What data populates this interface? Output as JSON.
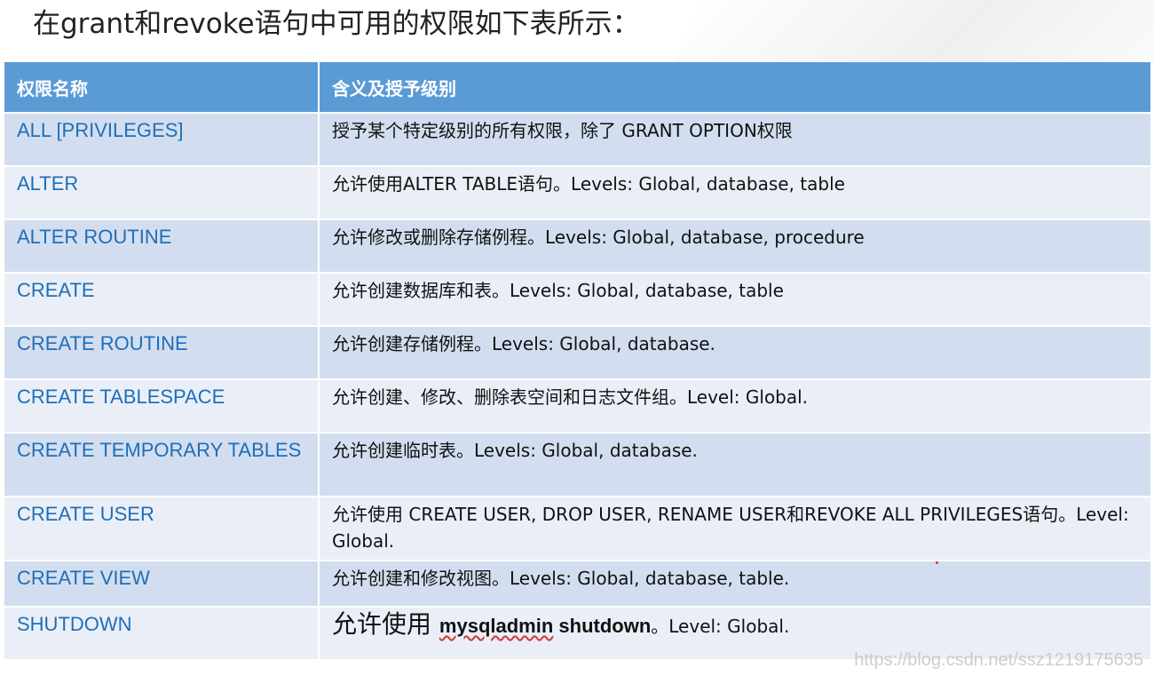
{
  "title": "在grant和revoke语句中可用的权限如下表所示：",
  "table": {
    "headers": [
      "权限名称",
      "含义及授予级别"
    ],
    "rows": [
      {
        "name": "ALL [PRIVILEGES]",
        "desc": "授予某个特定级别的所有权限，除了 GRANT  OPTION权限"
      },
      {
        "name": "ALTER",
        "desc": "允许使用ALTER  TABLE语句。Levels: Global, database, table"
      },
      {
        "name": "ALTER ROUTINE",
        "desc": "允许修改或删除存储例程。Levels: Global, database, procedure"
      },
      {
        "name": "CREATE",
        "desc": "允许创建数据库和表。Levels: Global, database, table"
      },
      {
        "name": "CREATE ROUTINE",
        "desc": "允许创建存储例程。Levels: Global, database."
      },
      {
        "name": "CREATE TABLESPACE",
        "desc": "允许创建、修改、删除表空间和日志文件组。Level: Global."
      },
      {
        "name": "CREATE TEMPORARY TABLES",
        "desc": "允许创建临时表。Levels: Global, database."
      },
      {
        "name": "CREATE USER",
        "desc": "允许使用 CREATE USER, DROP USER, RENAME USER和REVOKE ALL PRIVILEGES语句。Level: Global."
      },
      {
        "name": "CREATE VIEW",
        "desc": "允许创建和修改视图。Levels: Global, database, table."
      }
    ],
    "last_row": {
      "name": "SHUTDOWN",
      "desc_big": "允许使用 ",
      "desc_cmd_mysql": "mysqladmin",
      "desc_cmd_rest": " shutdown",
      "desc_tail": "。Level: Global."
    }
  },
  "watermark": "https://blog.csdn.net/ssz1219175635",
  "colors": {
    "header_bg": "#5b9bd5",
    "row_odd": "#d2deef",
    "row_even": "#eaeff7",
    "name_text": "#1f6eb8"
  }
}
